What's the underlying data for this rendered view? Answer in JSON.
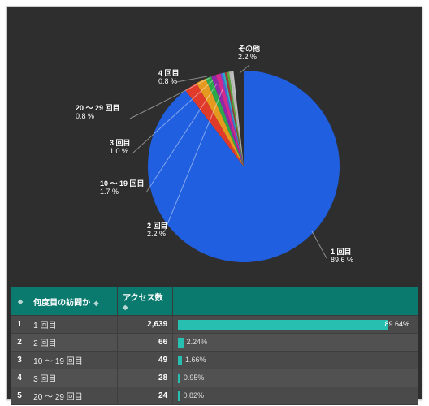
{
  "chart_data": {
    "type": "pie",
    "title": "",
    "slices": [
      {
        "label": "1 回目",
        "value": 2639,
        "pct": 89.6,
        "color": "#1f5fe0"
      },
      {
        "label": "2 回目",
        "value": 66,
        "pct": 2.2,
        "color": "#e03a2a"
      },
      {
        "label": "10 〜 19 回目",
        "value": 49,
        "pct": 1.7,
        "color": "#e59a1f"
      },
      {
        "label": "3 回目",
        "value": 28,
        "pct": 1.0,
        "color": "#2aa84a"
      },
      {
        "label": "20 〜 29 回目",
        "value": 24,
        "pct": 0.8,
        "color": "#8e2aa8"
      },
      {
        "label": "4 回目",
        "value": null,
        "pct": 0.8,
        "color": "#d42a8e"
      },
      {
        "label": "その他",
        "value": null,
        "pct": 2.2,
        "color": "#c0c0c0"
      }
    ],
    "other_colors": [
      "#5a5ad4",
      "#2ab0c0",
      "#a03a3a",
      "#5aa83a",
      "#bbbbbb"
    ]
  },
  "callouts": {
    "s1": {
      "label": "1 回目",
      "pct": "89.6 %"
    },
    "s2": {
      "label": "2 回目",
      "pct": "2.2 %"
    },
    "s3": {
      "label": "10 〜 19 回目",
      "pct": "1.7 %"
    },
    "s4": {
      "label": "3 回目",
      "pct": "1.0 %"
    },
    "s5": {
      "label": "20 〜 29 回目",
      "pct": "0.8 %"
    },
    "s6": {
      "label": "4 回目",
      "pct": "0.8 %"
    },
    "other": {
      "label": "その他",
      "pct": "2.2 %"
    }
  },
  "table": {
    "headers": {
      "rank": "",
      "category": "何度目の訪問か",
      "count": "アクセス数"
    },
    "rows": [
      {
        "rank": "1",
        "category": "1 回目",
        "count": "2,639",
        "pct": "89.64%",
        "bar_pct": 89.64
      },
      {
        "rank": "2",
        "category": "2 回目",
        "count": "66",
        "pct": "2.24%",
        "bar_pct": 2.24
      },
      {
        "rank": "3",
        "category": "10 〜 19 回目",
        "count": "49",
        "pct": "1.66%",
        "bar_pct": 1.66
      },
      {
        "rank": "4",
        "category": "3 回目",
        "count": "28",
        "pct": "0.95%",
        "bar_pct": 0.95
      },
      {
        "rank": "5",
        "category": "20 〜 29 回目",
        "count": "24",
        "pct": "0.82%",
        "bar_pct": 0.82
      }
    ]
  }
}
